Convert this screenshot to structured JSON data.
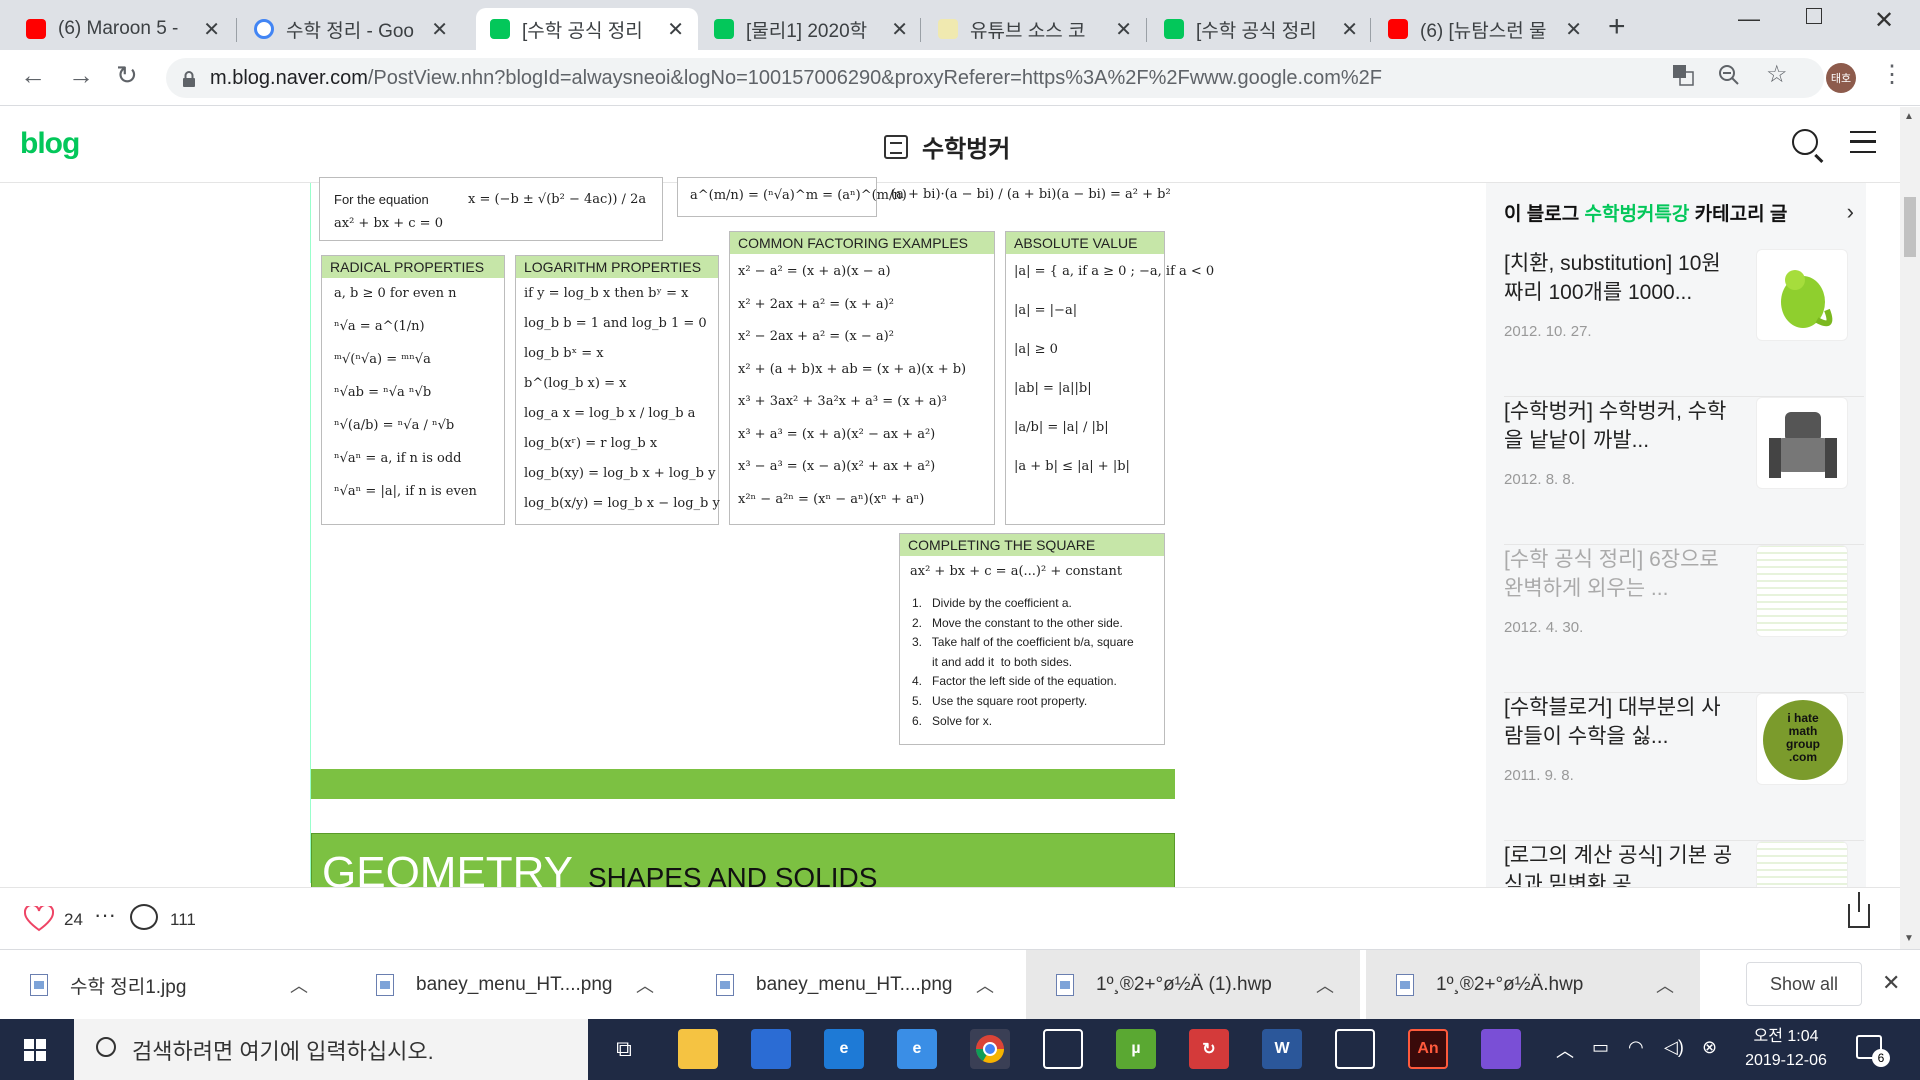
{
  "browser": {
    "tabs": [
      {
        "title": "(6) Maroon 5 -",
        "favicon": "youtube-icon",
        "active": false
      },
      {
        "title": "수학 정리 - Goo",
        "favicon": "google-icon",
        "active": false
      },
      {
        "title": "[수학 공식 정리",
        "favicon": "naver-blog-icon",
        "active": true
      },
      {
        "title": "[물리1] 2020학",
        "favicon": "naver-blog-icon",
        "active": false
      },
      {
        "title": "유튜브 소스 코",
        "favicon": "blog-icon",
        "active": false
      },
      {
        "title": "[수학 공식 정리",
        "favicon": "naver-blog-icon",
        "active": false
      },
      {
        "title": "(6) [뉴탐스런 물",
        "favicon": "youtube-icon",
        "active": false
      }
    ],
    "url_host": "m.blog.naver.com",
    "url_path": "/PostView.nhn?blogId=alwaysneoi&logNo=100157006290&proxyReferer=https%3A%2F%2Fwww.google.com%2F",
    "profile_initials": "태호"
  },
  "blog": {
    "logo": "blog",
    "title": "수학벙커"
  },
  "sheet": {
    "quad": {
      "label": "For the equation",
      "eq": "ax² + bx + c = 0",
      "formula": "x = (−b ± √(b² − 4ac)) / 2a"
    },
    "top_frag1": "a^(m/n) = (ⁿ√a)^m = (aⁿ)^(m/n)",
    "top_frag2": "(a + bi)·(a − bi) / (a + bi)(a − bi) = a² + b²",
    "radical": {
      "header": "RADICAL PROPERTIES",
      "lines": [
        "a, b ≥ 0 for even n",
        "ⁿ√a = a^(1/n)",
        "ᵐ√(ⁿ√a) = ᵐⁿ√a",
        "ⁿ√ab = ⁿ√a ⁿ√b",
        "ⁿ√(a/b) = ⁿ√a / ⁿ√b",
        "ⁿ√aⁿ = a, if n is odd",
        "ⁿ√aⁿ = |a|, if n is even"
      ]
    },
    "log": {
      "header": "LOGARITHM PROPERTIES",
      "lines": [
        "if y = log_b x then bʸ = x",
        "log_b b = 1  and  log_b 1 = 0",
        "log_b bˣ = x",
        "b^(log_b x) = x",
        "log_a x = log_b x / log_b a",
        "log_b(xʳ) = r log_b x",
        "log_b(xy) = log_b x + log_b y",
        "log_b(x/y) = log_b x − log_b y"
      ]
    },
    "factoring": {
      "header": "COMMON FACTORING EXAMPLES",
      "lines": [
        "x² − a² = (x + a)(x − a)",
        "x² + 2ax + a² = (x + a)²",
        "x² − 2ax + a² = (x − a)²",
        "x² + (a + b)x + ab = (x + a)(x + b)",
        "x³ + 3ax² + 3a²x + a³ = (x + a)³",
        "x³ + a³ = (x + a)(x² − ax + a²)",
        "x³ − a³ = (x − a)(x² + ax + a²)",
        "x²ⁿ − a²ⁿ = (xⁿ − aⁿ)(xⁿ + aⁿ)"
      ]
    },
    "absolute": {
      "header": "ABSOLUTE VALUE",
      "lines": [
        "|a| = { a, if a ≥ 0 ; −a, if a < 0",
        "|a| = |−a|",
        "|a| ≥ 0",
        "|ab| = |a||b|",
        "|a/b| = |a| / |b|",
        "|a + b| ≤ |a| + |b|"
      ]
    },
    "square": {
      "header": "COMPLETING THE SQUARE",
      "eq": "ax² + bx + c = a(...)² + constant",
      "steps": [
        "1.   Divide by the coefficient a.",
        "2.   Move the constant to the other side.",
        "3.   Take half of the coefficient b/a, square",
        "      it and add it  to both sides.",
        "4.   Factor the left side of the equation.",
        "5.   Use the square root property.",
        "6.   Solve for x."
      ]
    },
    "geometry_big": "GEOMETRY",
    "geometry_small": "SHAPES AND SOLIDS"
  },
  "sidebar": {
    "head_prefix": "이 블로그 ",
    "head_category": "수학벙커특강",
    "head_suffix": " 카테고리 글",
    "items": [
      {
        "title": "[치환, substitution] 10원짜리 100개를 1000...",
        "date": "2012. 10. 27.",
        "thumb": "chameleon-thumb"
      },
      {
        "title": "[수학벙커] 수학벙커, 수학을 낱낱이 까발...",
        "date": "2012. 8. 8.",
        "thumb": "robot-thumb"
      },
      {
        "title": "[수학 공식 정리] 6장으로 완벽하게 외우는 ...",
        "date": "2012. 4. 30.",
        "thumb": "cheatsheet-thumb",
        "dim": true
      },
      {
        "title": "[수학블로거] 대부분의 사람들이 수학을 싫...",
        "date": "2011. 9. 8.",
        "thumb": "ihatemath-thumb"
      },
      {
        "title": "[로그의 계산 공식] 기본 공식과 밑변환 공",
        "date": "",
        "thumb": "log-thumb"
      }
    ],
    "ihatemath_text": "i hate math group .com"
  },
  "actions": {
    "likes": "24",
    "comments": "111"
  },
  "downloads": [
    {
      "name": "수학 정리1.jpg",
      "gray": false
    },
    {
      "name": "baney_menu_HT....png",
      "gray": false
    },
    {
      "name": "baney_menu_HT....png",
      "gray": false
    },
    {
      "name": "1º¸®2+°ø½Ä (1).hwp",
      "gray": true
    },
    {
      "name": "1º¸®2+°ø½Ä.hwp",
      "gray": true
    }
  ],
  "show_all": "Show all",
  "taskbar": {
    "search_placeholder": "검색하려면 여기에 입력하십시오.",
    "time": "오전 1:04",
    "date": "2019-12-06",
    "notifications": "6",
    "apps": [
      {
        "name": "file-explorer-icon",
        "color": "#f5c342",
        "glyph": ""
      },
      {
        "name": "store-icon",
        "color": "#2b6cd4",
        "glyph": ""
      },
      {
        "name": "edge-icon",
        "color": "#1e7ad6",
        "glyph": "e"
      },
      {
        "name": "internet-explorer-icon",
        "color": "#3a8ee6",
        "glyph": "e"
      },
      {
        "name": "chrome-icon",
        "color": "#4a4a4a",
        "glyph": ""
      },
      {
        "name": "mail-icon",
        "color": "#ffffff",
        "glyph": ""
      },
      {
        "name": "utorrent-icon",
        "color": "#5aa832",
        "glyph": "µ"
      },
      {
        "name": "sync-icon",
        "color": "#d43a3a",
        "glyph": "↻"
      },
      {
        "name": "word-icon",
        "color": "#2b579a",
        "glyph": "W"
      },
      {
        "name": "photos-icon",
        "color": "#ffffff",
        "glyph": ""
      },
      {
        "name": "animate-icon",
        "color": "#3a0a0a",
        "glyph": "An"
      },
      {
        "name": "maps-pin-icon",
        "color": "#7a4fd6",
        "glyph": ""
      }
    ]
  }
}
